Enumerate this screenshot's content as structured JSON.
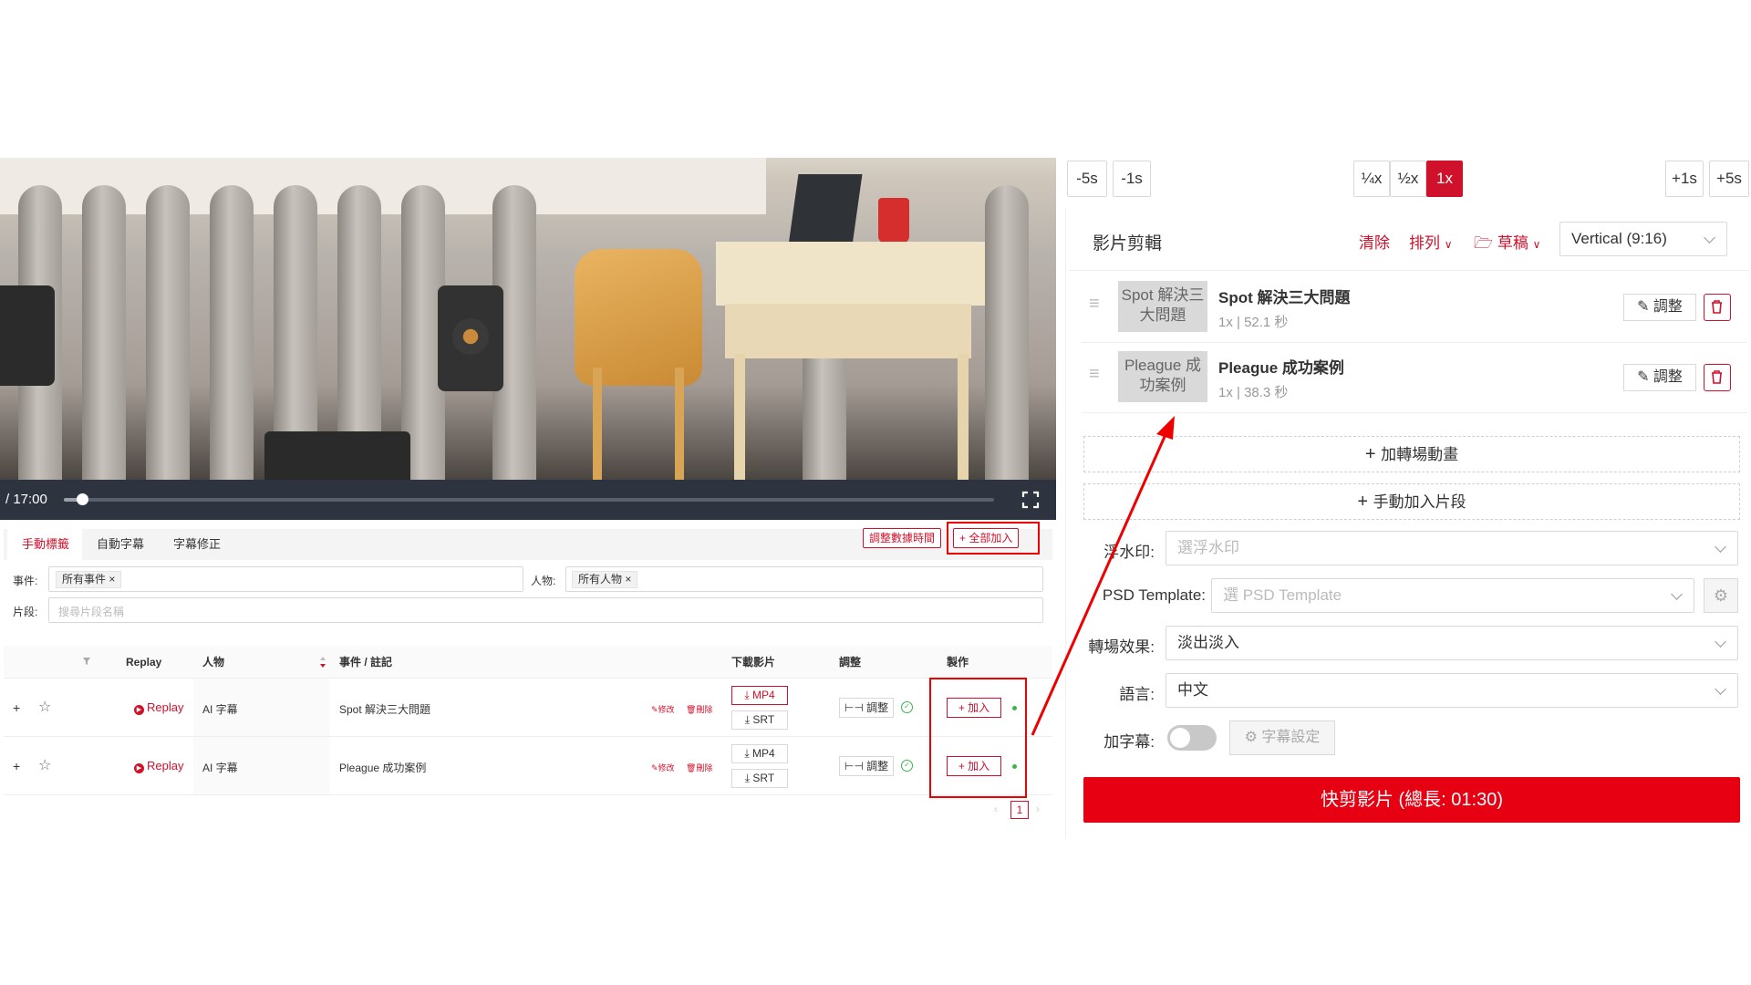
{
  "player": {
    "time_display": "/ 17:00",
    "progress_fraction": 0.02
  },
  "tabs": [
    {
      "label": "手動標籤",
      "active": true
    },
    {
      "label": "自動字幕",
      "active": false
    },
    {
      "label": "字幕修正",
      "active": false
    }
  ],
  "toolbar": {
    "adjust_time_label": "調整數據時間",
    "add_all_label": "全部加入"
  },
  "filters": {
    "event_label": "事件:",
    "event_chip": "所有事件",
    "person_label": "人物:",
    "person_chip": "所有人物",
    "segment_label": "片段:",
    "segment_placeholder": "搜尋片段名稱"
  },
  "table": {
    "columns": [
      "Replay",
      "人物",
      "事件 / 註記",
      "下載影片",
      "調整",
      "製作"
    ],
    "rows": [
      {
        "replay": "Replay",
        "person": "AI 字幕",
        "event": "Spot 解決三大問題",
        "edit": "修改",
        "delete": "刪除",
        "mp4": "MP4",
        "srt": "SRT",
        "adjust": "調整",
        "add": "加入",
        "mp4_active": true
      },
      {
        "replay": "Replay",
        "person": "AI 字幕",
        "event": "Pleague 成功案例",
        "edit": "修改",
        "delete": "刪除",
        "mp4": "MP4",
        "srt": "SRT",
        "adjust": "調整",
        "add": "加入",
        "mp4_active": false
      }
    ],
    "page": "1"
  },
  "playback": {
    "back5": "-5s",
    "back1": "-1s",
    "quarter": "¼x",
    "half": "½x",
    "normal": "1x",
    "fwd1": "+1s",
    "fwd5": "+5s"
  },
  "editor": {
    "title": "影片剪輯",
    "clear": "清除",
    "sort": "排列",
    "draft": "草稿",
    "aspect": "Vertical (9:16)",
    "clips": [
      {
        "thumb": "Spot 解決三大問題",
        "title": "Spot 解決三大問題",
        "meta": "1x | 52.1 秒",
        "adjust": "調整"
      },
      {
        "thumb": "Pleague 成功案例",
        "title": "Pleague 成功案例",
        "meta": "1x | 38.3 秒",
        "adjust": "調整"
      }
    ],
    "add_transition": "加轉場動畫",
    "add_manual": "手動加入片段",
    "watermark_label": "浮水印:",
    "watermark_placeholder": "選浮水印",
    "psd_label": "PSD Template:",
    "psd_placeholder": "選 PSD Template",
    "transition_label": "轉場效果:",
    "transition_value": "淡出淡入",
    "language_label": "語言:",
    "language_value": "中文",
    "subtitle_label": "加字幕:",
    "subtitle_settings": "字幕設定",
    "render_button": "快剪影片 (總長: 01:30)"
  },
  "colors": {
    "accent": "#d0112b",
    "render": "#e60012",
    "player_bar": "#2d3440"
  }
}
